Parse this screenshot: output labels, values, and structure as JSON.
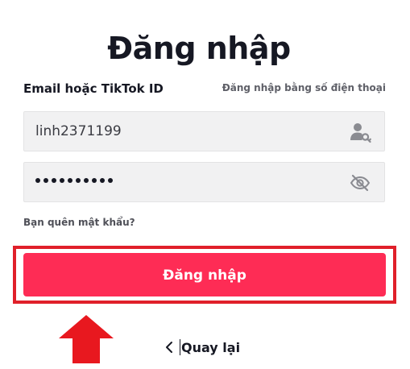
{
  "page": {
    "title": "Đăng nhập"
  },
  "form": {
    "field_label": "Email hoặc TikTok ID",
    "phone_login_link": "Đăng nhập bằng số điện thoại",
    "username_value": "linh2371199",
    "password_mask_length": 10,
    "forgot_password": "Bạn quên mật khẩu?",
    "submit_label": "Đăng nhập"
  },
  "footer": {
    "back_label": "Quay lại"
  },
  "icons": {
    "username": "user-key-icon",
    "password_toggle": "eye-off-icon",
    "back": "chevron-left-icon",
    "annotation": "red-up-arrow"
  },
  "colors": {
    "accent": "#fe2c55",
    "highlight": "#e0202a",
    "input_bg": "#f1f1f2",
    "text": "#161823"
  }
}
